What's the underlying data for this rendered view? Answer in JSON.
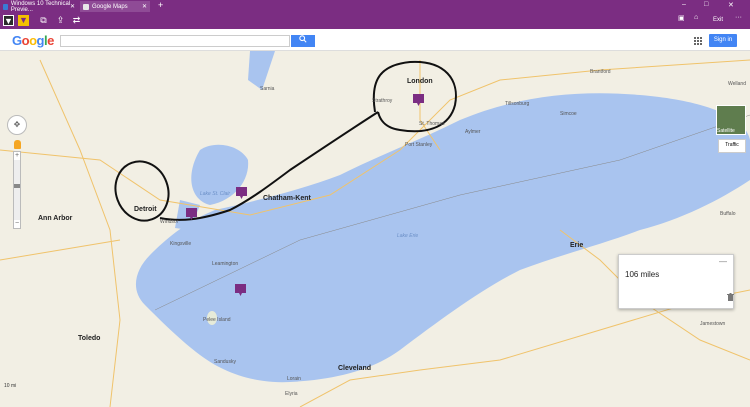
{
  "browser": {
    "tabs": [
      {
        "label": "Windows 10 Technical Previe..."
      },
      {
        "label": "Google Maps"
      }
    ],
    "new_tab": "+",
    "window_controls": {
      "minimize": "–",
      "maximize": "□",
      "close": "✕"
    },
    "command_bar": {
      "exit_label": "Exit",
      "more": "···"
    },
    "accent_color": "#7b2d82"
  },
  "google": {
    "logo": [
      "G",
      "o",
      "o",
      "g",
      "l",
      "e"
    ],
    "search": {
      "value": "",
      "placeholder": ""
    },
    "signin_label": "Sign in",
    "brand_blue": "#4285f4"
  },
  "map": {
    "controls": {
      "pan_icon": "pan-control-icon",
      "zoom_in": "+",
      "zoom_out": "−",
      "satellite_label": "Satellite",
      "traffic_label": "Traffic"
    },
    "measure_panel": {
      "distance": "106 miles",
      "close": "—",
      "delete_icon": "trash-icon"
    },
    "labels": {
      "london": "London",
      "chatham_kent": "Chatham-Kent",
      "lake_st_clair": "Lake St. Clair",
      "lake_erie": "Lake Erie",
      "leamington": "Leamington",
      "cleveland": "Cleveland",
      "st_thomas": "St. Thomas",
      "port_stanley": "Port Stanley",
      "sarnia": "Sarnia",
      "ann_arbor": "Ann Arbor",
      "toledo": "Toledo",
      "sandusky": "Sandusky",
      "erie": "Erie",
      "strathroy": "Strathroy",
      "detroit": "Detroit",
      "windsor": "Windsor",
      "pelee": "Pelee Island",
      "welland": "Welland",
      "buffalo": "Buffalo",
      "lorain": "Lorain",
      "elyria": "Elyria",
      "jamestown": "Jamestown",
      "kingsville": "Kingsville",
      "brantford": "Brantford",
      "simcoe": "Simcoe",
      "tillsonburg": "Tillsonburg",
      "aylmer": "Aylmer"
    },
    "scale_label": "10 mi",
    "water_color": "#a9c4ef",
    "land_color": "#f2efe4",
    "marker_color": "#7b2d82"
  }
}
